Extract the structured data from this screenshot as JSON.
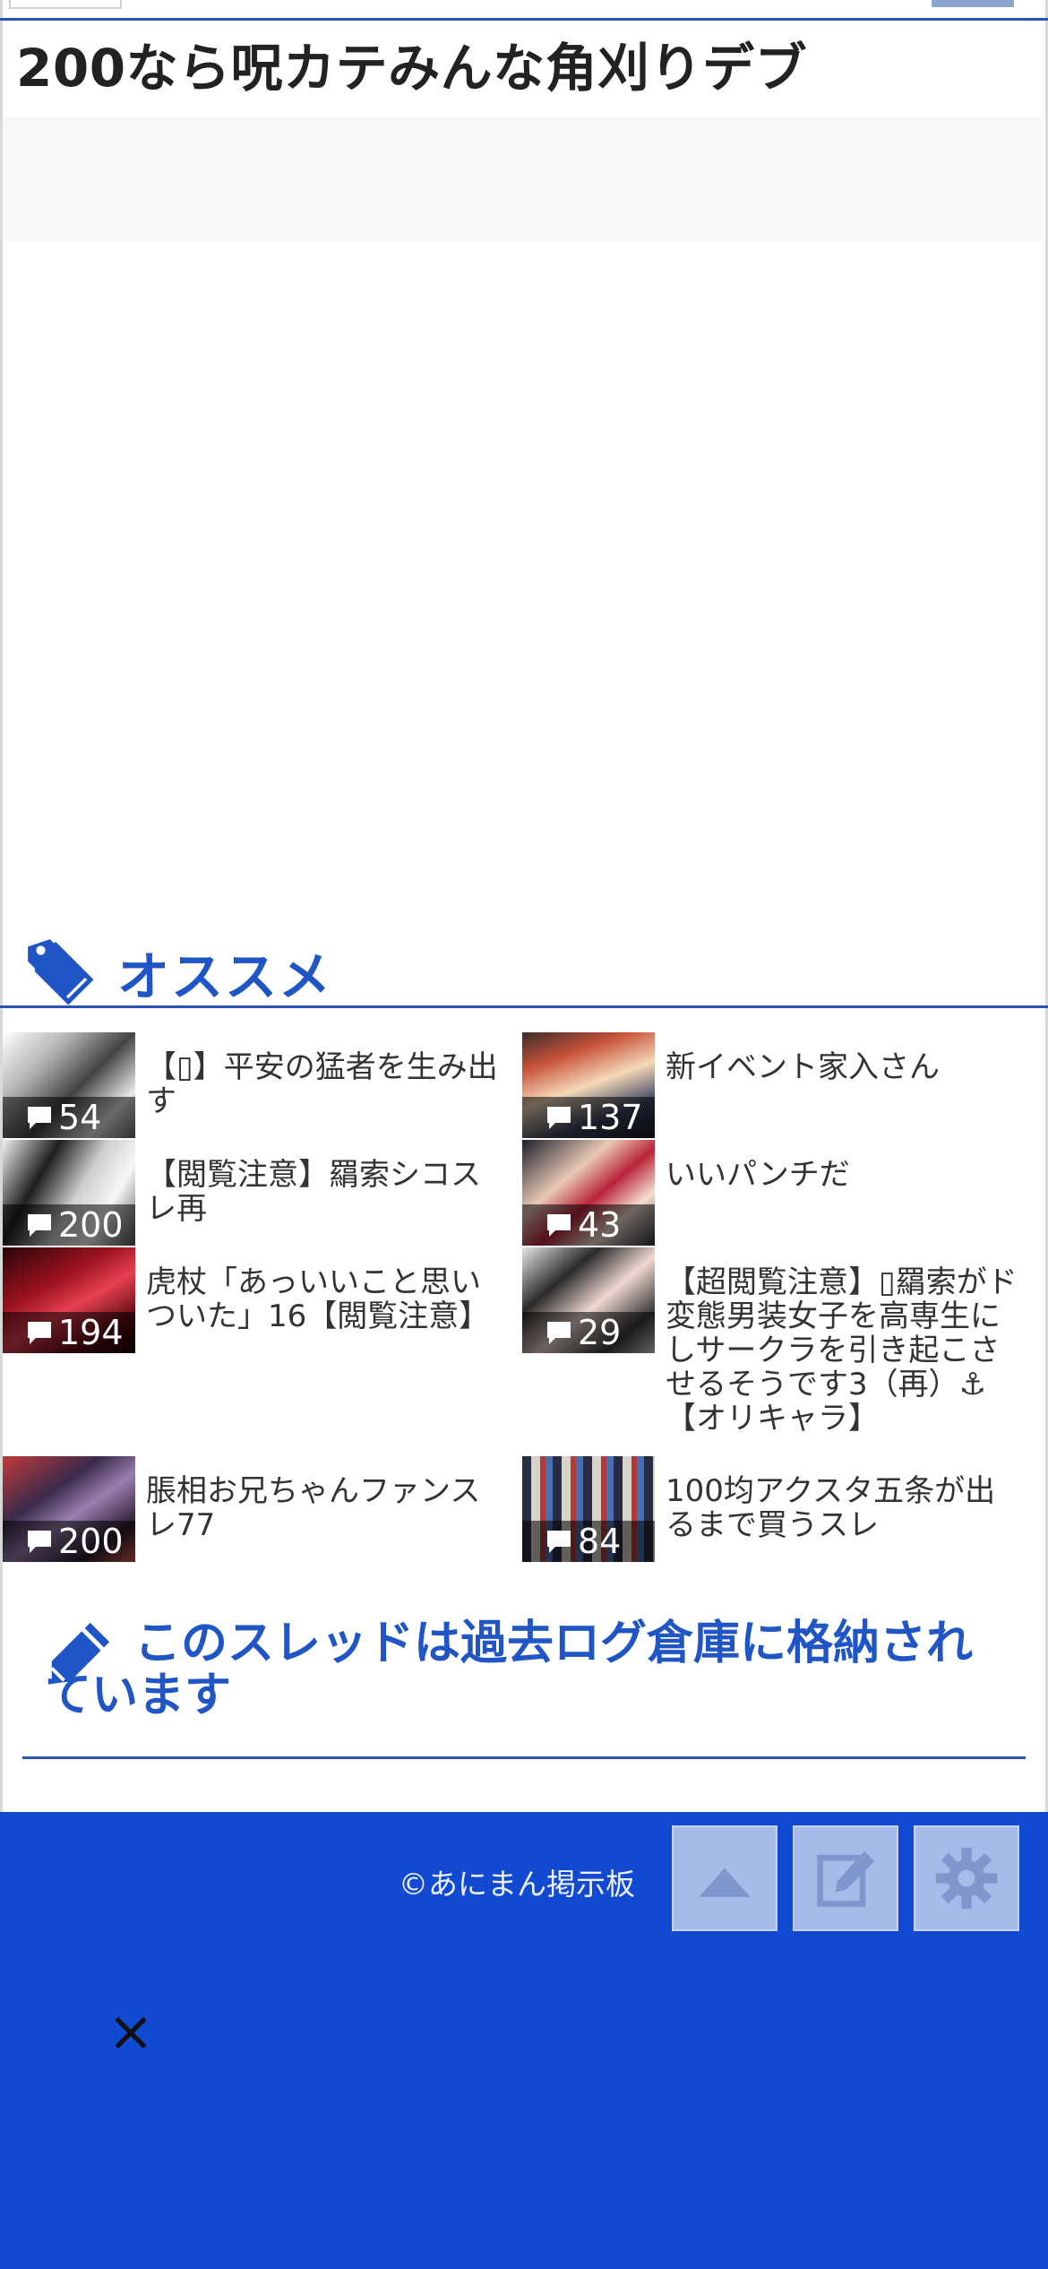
{
  "page_title": "200なら呪カテみんな角刈りデブ",
  "recommend": {
    "heading": "オススメ",
    "items": [
      {
        "title": "【▯】平安の猛者を生み出す",
        "count": "54"
      },
      {
        "title": "新イベント家入さん",
        "count": "137"
      },
      {
        "title": "【閲覧注意】羂索シコスレ再",
        "count": "200"
      },
      {
        "title": "いいパンチだ",
        "count": "43"
      },
      {
        "title": "虎杖「あっいいこと思いついた」16【閲覧注意】",
        "count": "194"
      },
      {
        "title": "【超閲覧注意】▯羂索がド変態男装女子を高専生にしサークラを引き起こさせるそうです3（再）⚓【オリキャラ】",
        "count": "29"
      },
      {
        "title": "脹相お兄ちゃんファンスレ77",
        "count": "200"
      },
      {
        "title": "100均アクスタ五条が出るまで買うスレ",
        "count": "84"
      }
    ]
  },
  "archive_notice": "このスレッドは過去ログ倉庫に格納されています",
  "footer": {
    "copyright": "©あにまん掲示板",
    "close_symbol": "×"
  },
  "colors": {
    "accent": "#1f55c4",
    "footer_bg": "#1249d1",
    "button_bg": "#a6bbe8"
  },
  "icons": [
    "tag-icon",
    "comment-icon",
    "pencil-icon",
    "arrow-up-icon",
    "edit-icon",
    "gear-icon",
    "close-icon"
  ]
}
